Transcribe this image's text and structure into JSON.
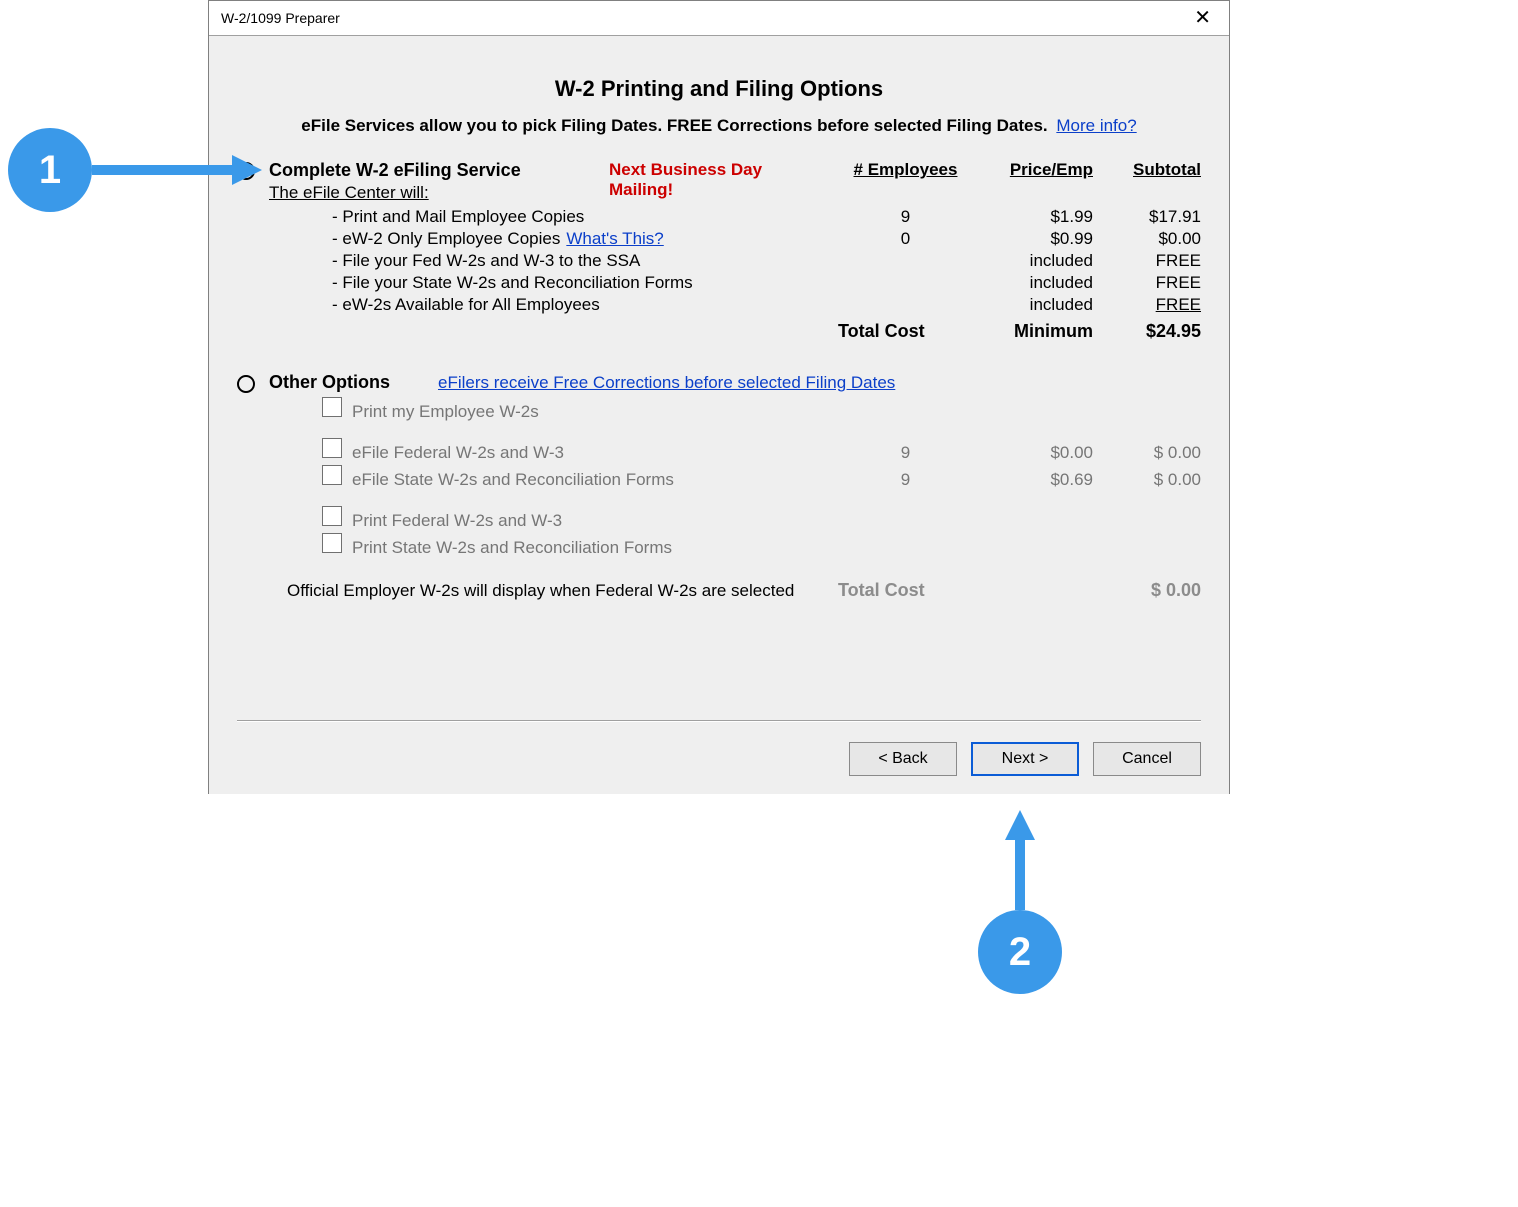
{
  "window": {
    "title": "W-2/1099 Preparer"
  },
  "header": {
    "page_title": "W-2 Printing and Filing Options",
    "sub_title": "eFile Services allow you to pick Filing Dates. FREE Corrections before selected Filing Dates.",
    "more_info": "More info?"
  },
  "columns": {
    "employees": "# Employees",
    "price": "Price/Emp",
    "subtotal": "Subtotal"
  },
  "option_complete": {
    "label": "Complete W-2 eFiling Service",
    "efile_center": "The eFile Center will:",
    "nbd_line1": "Next Business Day",
    "nbd_line2": "Mailing!",
    "items": [
      {
        "desc": "Print and Mail Employee Copies",
        "emp": "9",
        "price": "$1.99",
        "sub": "$17.91"
      },
      {
        "desc": "eW-2 Only Employee Copies",
        "whats_this": "What's This?",
        "emp": "0",
        "price": "$0.99",
        "sub": "$0.00"
      },
      {
        "desc": "File your Fed W-2s and W-3 to the SSA",
        "emp": "",
        "price": "included",
        "sub": "FREE"
      },
      {
        "desc": "File your State W-2s and Reconciliation Forms",
        "emp": "",
        "price": "included",
        "sub": "FREE"
      },
      {
        "desc": "eW-2s Available for All Employees",
        "emp": "",
        "price": "included",
        "sub": "FREE",
        "sub_underline": true
      }
    ],
    "total_cost_label": "Total Cost",
    "minimum_label": "Minimum",
    "total": "$24.95"
  },
  "option_other": {
    "label": "Other Options",
    "efilers_link": "eFilers receive Free Corrections before selected Filing Dates",
    "items": [
      {
        "desc": "Print my Employee W-2s",
        "emp": "",
        "price": "",
        "sub": ""
      },
      {
        "gap": true
      },
      {
        "desc": "eFile Federal W-2s and W-3",
        "emp": "9",
        "price": "$0.00",
        "sub": "$ 0.00"
      },
      {
        "desc": "eFile State W-2s and Reconciliation Forms",
        "emp": "9",
        "price": "$0.69",
        "sub": "$ 0.00"
      },
      {
        "gap": true
      },
      {
        "desc": "Print Federal W-2s and W-3",
        "emp": "",
        "price": "",
        "sub": ""
      },
      {
        "desc": "Print State W-2s and Reconciliation Forms",
        "emp": "",
        "price": "",
        "sub": ""
      }
    ],
    "note": "Official Employer W-2s will display when Federal W-2s are selected",
    "total_cost_label": "Total Cost",
    "total": "$ 0.00"
  },
  "buttons": {
    "back": "< Back",
    "next": "Next >",
    "cancel": "Cancel"
  },
  "callouts": {
    "one": "1",
    "two": "2"
  }
}
